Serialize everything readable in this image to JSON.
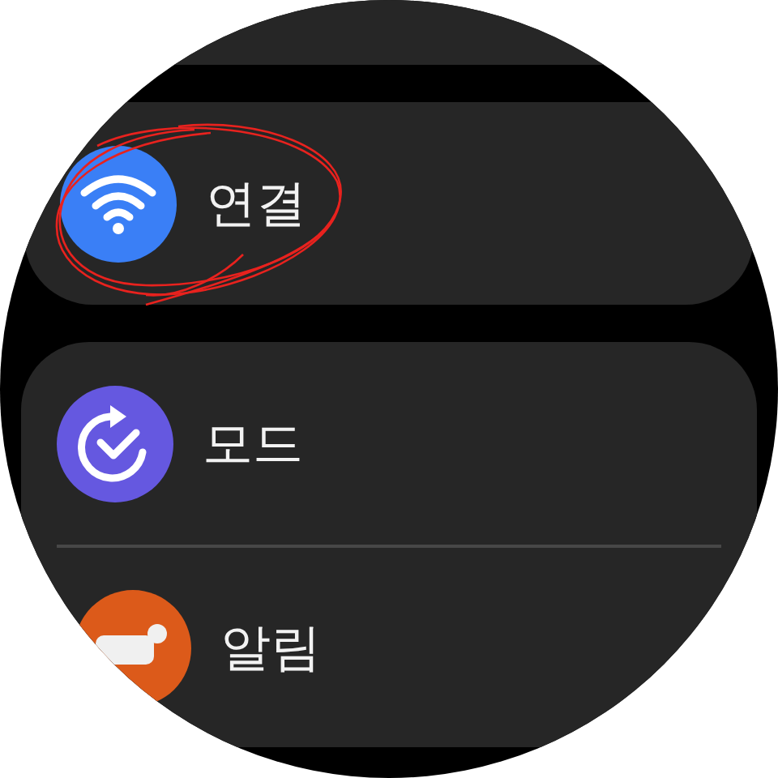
{
  "groups": [
    {
      "items": [
        {
          "label": "연결",
          "kind": "wifi",
          "color": "#3a7ff6"
        }
      ]
    },
    {
      "items": [
        {
          "label": "모드",
          "kind": "mode",
          "color": "#6558e0"
        },
        {
          "label": "알림",
          "kind": "alert",
          "color": "#dc5a1a"
        }
      ]
    }
  ]
}
